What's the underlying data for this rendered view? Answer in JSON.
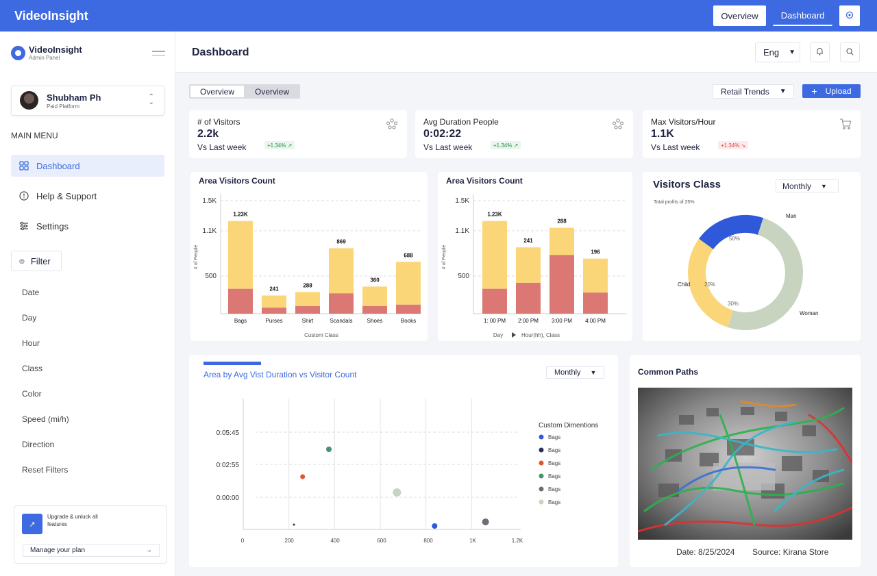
{
  "topbar": {
    "brand": "VideoInsight",
    "overview_label": "Overview",
    "dashboard_label": "Dashboard"
  },
  "sidebar": {
    "logo_name": "VideoInsight",
    "logo_sub": "Admin Panel",
    "user_name": "Shubham Ph",
    "user_plan": "Paid Platform",
    "menu_title": "MAIN MENU",
    "menu": [
      {
        "label": "Dashboard",
        "icon": "grid-icon",
        "active": true
      },
      {
        "label": "Help & Support",
        "icon": "info-icon",
        "active": false
      },
      {
        "label": "Settings",
        "icon": "sliders-icon",
        "active": false
      }
    ],
    "filter_label": "Filter",
    "filters": [
      "Date",
      "Day",
      "Hour",
      "Class",
      "Color",
      "Speed (mi/h)",
      "Direction",
      "Reset Filters"
    ],
    "upgrade_text": "Upgrade & unluck all features",
    "manage_plan": "Manage your plan"
  },
  "header": {
    "title": "Dashboard",
    "language": "Eng"
  },
  "toolbar": {
    "seg_a": "Overview",
    "seg_b": "Overview",
    "retail_trends": "Retail Trends",
    "upload": "Upload"
  },
  "stats": [
    {
      "label": "# of Visitors",
      "value": "2.2k",
      "sub": "Vs Last week",
      "change": "+1.34%",
      "trend": "up",
      "icon": "people-icon"
    },
    {
      "label": "Avg Duration People",
      "value": "0:02:22",
      "sub": "Vs Last week",
      "change": "+1.34%",
      "trend": "up",
      "icon": "people-icon"
    },
    {
      "label": "Max Visitors/Hour",
      "value": "1.1K",
      "sub": "Vs Last week",
      "change": "+1.34%",
      "trend": "down",
      "icon": "cart-icon"
    }
  ],
  "visitors_class": {
    "title": "Visitors Class",
    "dropdown": "Monthly",
    "subtitle": "Total profits of 25%"
  },
  "scatter_panel": {
    "title": "Area by Avg Vist Duration vs Visitor Count",
    "dropdown": "Monthly"
  },
  "common_paths": {
    "title": "Common Paths",
    "date": "Date: 8/25/2024",
    "source": "Source: Kirana Store"
  },
  "colors": {
    "accent": "#3e6ae1",
    "bar_top": "#fbd679",
    "bar_bottom": "#dc7874",
    "donut_man": "#c8d3c0",
    "donut_woman": "#fbd679",
    "donut_child": "#2f59d9"
  },
  "chart_data": [
    {
      "type": "bar",
      "title": "Area Visitors Count",
      "xlabel": "Custom Class",
      "ylabel": "# of People",
      "ylim": [
        0,
        1500
      ],
      "yticks": [
        "1.5K",
        "1.1K",
        "500"
      ],
      "categories": [
        "Bags",
        "Purses",
        "Shirt",
        "Scandals",
        "Shoes",
        "Books"
      ],
      "totals": [
        1230,
        241,
        288,
        869,
        360,
        688
      ],
      "total_labels": [
        "1.23K",
        "241",
        "288",
        "869",
        "360",
        "688"
      ],
      "series": [
        {
          "values": [
            330,
            80,
            100,
            270,
            100,
            120
          ]
        },
        {
          "values": [
            900,
            161,
            188,
            599,
            260,
            568
          ]
        }
      ]
    },
    {
      "type": "bar",
      "title": "Area Visitors Count",
      "xlabel": "Day",
      "xlabel2": "Hour(hh), Class",
      "ylabel": "# of People",
      "ylim": [
        0,
        1500
      ],
      "yticks": [
        "1.5K",
        "1.1K",
        "500"
      ],
      "categories": [
        "1: 00 PM",
        "2:00 PM",
        "3:00 PM",
        "4:00 PM"
      ],
      "totals": [
        1230,
        241,
        288,
        196
      ],
      "total_labels": [
        "1.23K",
        "241",
        "288",
        "196"
      ],
      "series": [
        {
          "values": [
            330,
            410,
            780,
            280
          ]
        },
        {
          "values": [
            900,
            470,
            360,
            450
          ]
        }
      ]
    },
    {
      "type": "pie",
      "title": "Visitors Class",
      "labels": [
        "Man",
        "Woman",
        "Child"
      ],
      "values": [
        50,
        30,
        20
      ],
      "value_labels": [
        "50%",
        "30%",
        "20%"
      ]
    },
    {
      "type": "scatter",
      "title": "Area by Avg Vist Duration vs Visitor Count",
      "xticks": [
        "0",
        "200",
        "400",
        "600",
        "800",
        "1K",
        "1.2K"
      ],
      "yticks": [
        "0:05:45",
        "0:02:55",
        "0:00:00"
      ],
      "legend_title": "Custom Dimentions",
      "legend": [
        {
          "name": "Bags",
          "color": "#2f59d9"
        },
        {
          "name": "Bags",
          "color": "#2b2f55"
        },
        {
          "name": "Bags",
          "color": "#e2552c"
        },
        {
          "name": "Bags",
          "color": "#4a9070"
        },
        {
          "name": "Bags",
          "color": "#6c6d7a"
        },
        {
          "name": "Bags",
          "color": "#c8d3c0"
        }
      ],
      "points": [
        {
          "x": 225,
          "y": -40,
          "color": "#2b2f55",
          "size": 1.5
        },
        {
          "x": 263,
          "y": 30,
          "color": "#e2552c",
          "size": 3.5
        },
        {
          "x": 378,
          "y": 70,
          "color": "#4a9070",
          "size": 4
        },
        {
          "x": 673,
          "y": 7,
          "color": "#c8d3c0",
          "size": 6
        },
        {
          "x": 838,
          "y": -42,
          "color": "#2f59d9",
          "size": 4
        },
        {
          "x": 1061,
          "y": -36,
          "color": "#6c6d7a",
          "size": 5
        }
      ]
    }
  ]
}
